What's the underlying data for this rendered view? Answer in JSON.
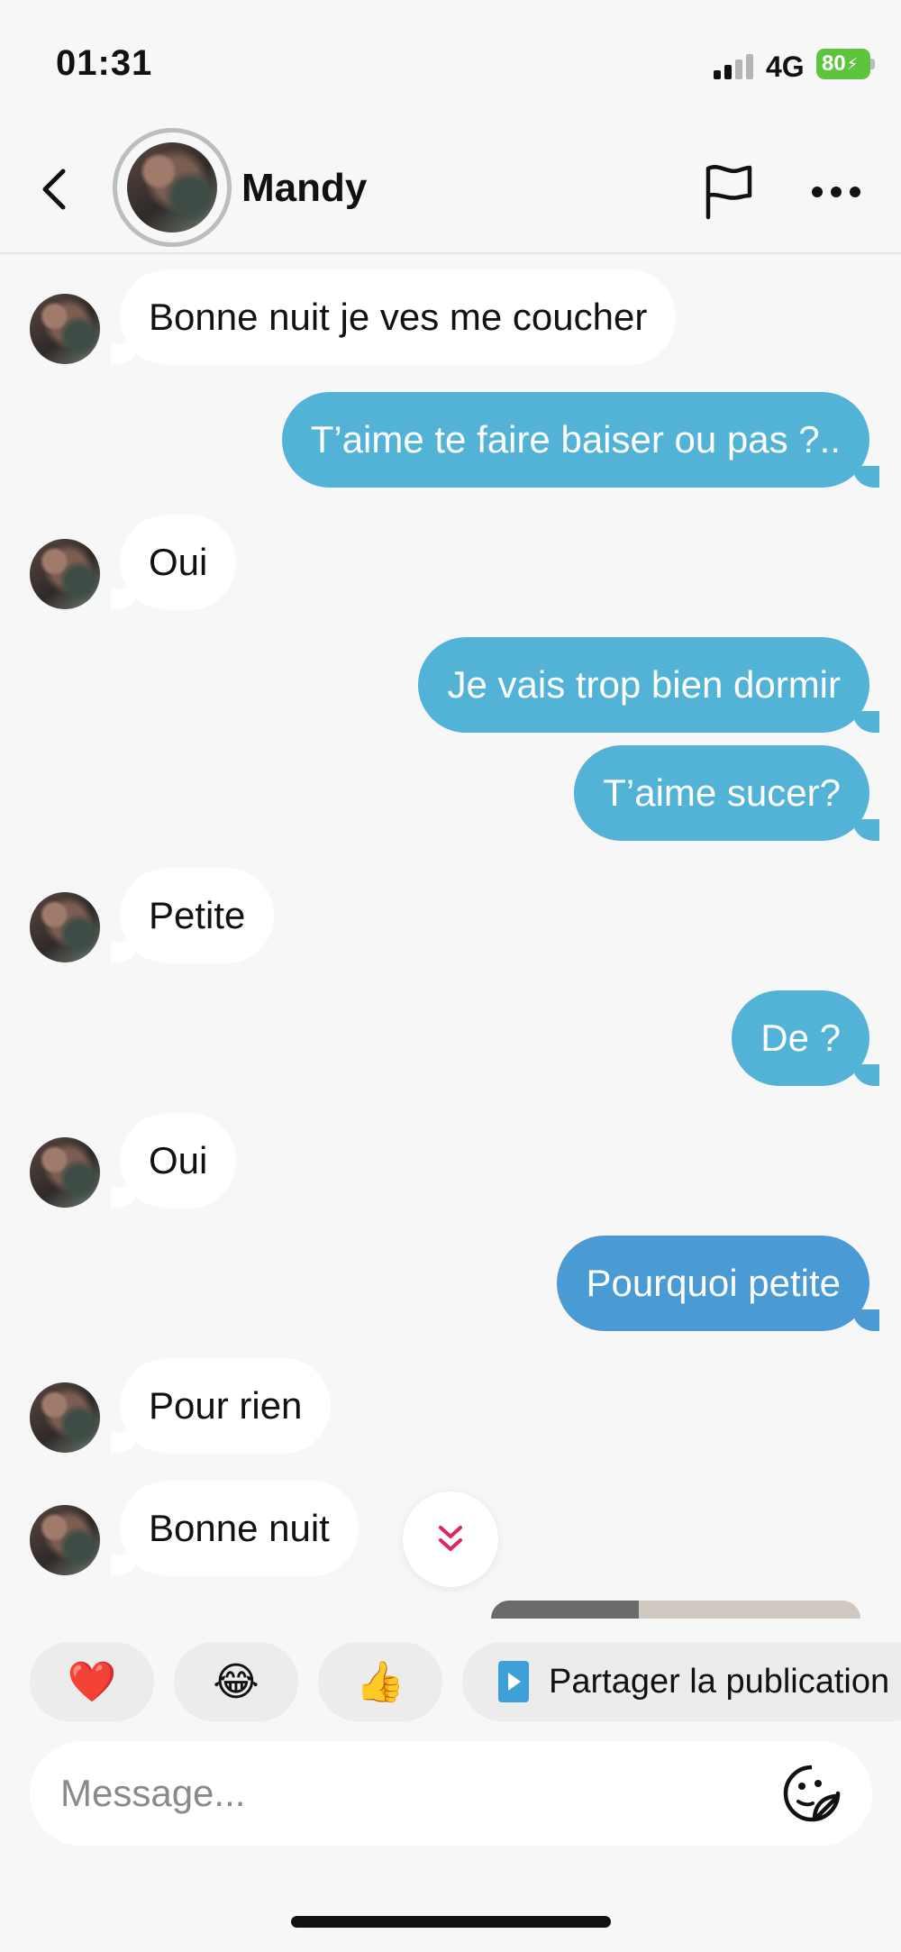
{
  "status_bar": {
    "time": "01:31",
    "network": "4G",
    "battery": "80"
  },
  "header": {
    "contact_name": "Mandy",
    "icons": [
      "back-arrow-icon",
      "flag-icon",
      "more-icon"
    ]
  },
  "messages": [
    {
      "direction": "in",
      "text": "Bonne nuit je ves me coucher",
      "avatar": true
    },
    {
      "direction": "out",
      "text": "T’aime te faire baiser ou pas ?.."
    },
    {
      "direction": "in",
      "text": "Oui",
      "avatar": true
    },
    {
      "direction": "out",
      "text": "Je vais trop bien dormir"
    },
    {
      "direction": "out",
      "text": "T’aime sucer?"
    },
    {
      "direction": "in",
      "text": "Petite",
      "avatar": true
    },
    {
      "direction": "out",
      "text": "De ?"
    },
    {
      "direction": "in",
      "text": "Oui",
      "avatar": true
    },
    {
      "direction": "out",
      "text": "Pourquoi petite"
    },
    {
      "direction": "in",
      "text": "Pour rien",
      "avatar": true
    },
    {
      "direction": "in",
      "text": "Bonne nuit",
      "avatar": true
    }
  ],
  "quick_replies": {
    "heart": "❤️",
    "laugh": "😂",
    "thumbs_up": "👍",
    "share_label": "Partager la publication"
  },
  "composer": {
    "placeholder": "Message..."
  },
  "colors": {
    "outgoing_bubble": "#53b3d6",
    "outgoing_bubble_last": "#4a9ad4",
    "incoming_bubble": "#ffffff",
    "background": "#f7f7f7",
    "scroll_chevron": "#e0245e"
  }
}
